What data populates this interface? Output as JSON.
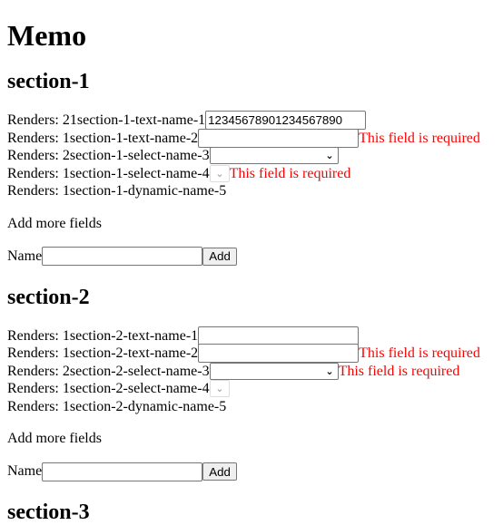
{
  "title": "Memo",
  "sections": [
    {
      "heading": "section-1",
      "rows": [
        {
          "label": "Renders: 21section-1-text-name-1",
          "value": "12345678901234567890",
          "error": ""
        },
        {
          "label": "Renders: 1section-1-text-name-2",
          "value": "",
          "error": "This field is required"
        },
        {
          "label": "Renders: 2section-1-select-name-3",
          "value": "",
          "error": ""
        },
        {
          "label": "Renders: 1section-1-select-name-4",
          "value": "",
          "error": "This field is required"
        },
        {
          "label": "Renders: 1section-1-dynamic-name-5"
        }
      ],
      "add_more": "Add more fields",
      "name_label": "Name",
      "name_value": "",
      "add_button": "Add"
    },
    {
      "heading": "section-2",
      "rows": [
        {
          "label": "Renders: 1section-2-text-name-1",
          "value": "",
          "error": ""
        },
        {
          "label": "Renders: 1section-2-text-name-2",
          "value": "",
          "error": "This field is required"
        },
        {
          "label": "Renders: 2section-2-select-name-3",
          "value": "",
          "error": "This field is required"
        },
        {
          "label": "Renders: 1section-2-select-name-4",
          "value": "",
          "error": ""
        },
        {
          "label": "Renders: 1section-2-dynamic-name-5"
        }
      ],
      "add_more": "Add more fields",
      "name_label": "Name",
      "name_value": "",
      "add_button": "Add"
    },
    {
      "heading": "section-3"
    }
  ],
  "colors": {
    "error": "#ff0000"
  }
}
